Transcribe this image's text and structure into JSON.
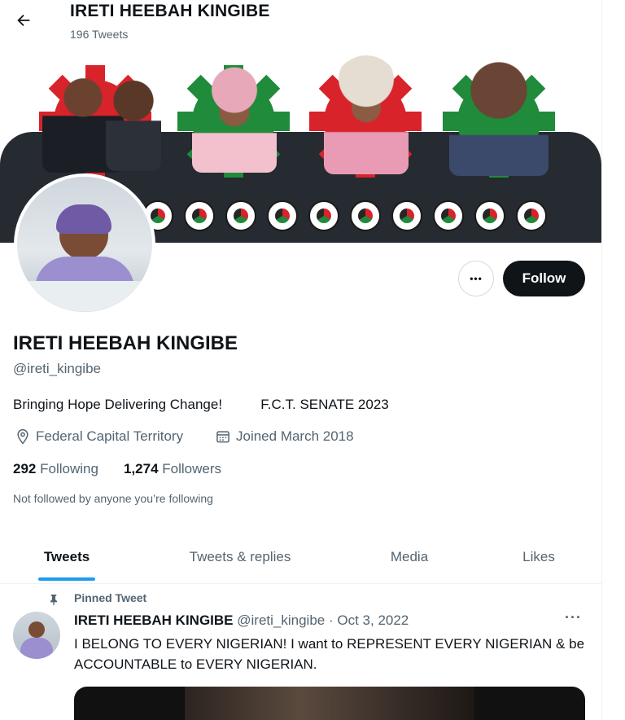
{
  "header": {
    "back_icon": "arrow-left-icon",
    "name": "IRETI HEEBAH KINGIBE",
    "tweet_count": "196 Tweets"
  },
  "banner": {
    "colors": {
      "red": "#d8232a",
      "green": "#1f8b3b",
      "dark": "#262a31"
    },
    "logo_count": 10
  },
  "profile": {
    "name": "IRETI HEEBAH KINGIBE",
    "handle": "@ireti_kingibe",
    "bio": "Bringing Hope Delivering Change!          F.C.T. SENATE 2023",
    "location_icon": "location-pin-icon",
    "location": "Federal Capital Territory",
    "joined_icon": "calendar-icon",
    "joined": "Joined March 2018",
    "following_count": "292",
    "following_label": "Following",
    "followers_count": "1,274",
    "followers_label": "Followers",
    "not_followed": "Not followed by anyone you’re following"
  },
  "actions": {
    "more_label": "•••",
    "follow_label": "Follow"
  },
  "tabs": [
    {
      "label": "Tweets",
      "active": true
    },
    {
      "label": "Tweets & replies",
      "active": false
    },
    {
      "label": "Media",
      "active": false
    },
    {
      "label": "Likes",
      "active": false
    }
  ],
  "tweet": {
    "pinned_label": "Pinned Tweet",
    "author": "IRETI HEEBAH KINGIBE",
    "handle": "@ireti_kingibe",
    "date": "· Oct 3, 2022",
    "more_label": "···",
    "text": "I BELONG TO EVERY NIGERIAN! I want to REPRESENT EVERY NIGERIAN & be ACCOUNTABLE  to EVERY NIGERIAN."
  },
  "colors": {
    "accent": "#1d9bf0",
    "text": "#0f1419",
    "muted": "#536471"
  }
}
